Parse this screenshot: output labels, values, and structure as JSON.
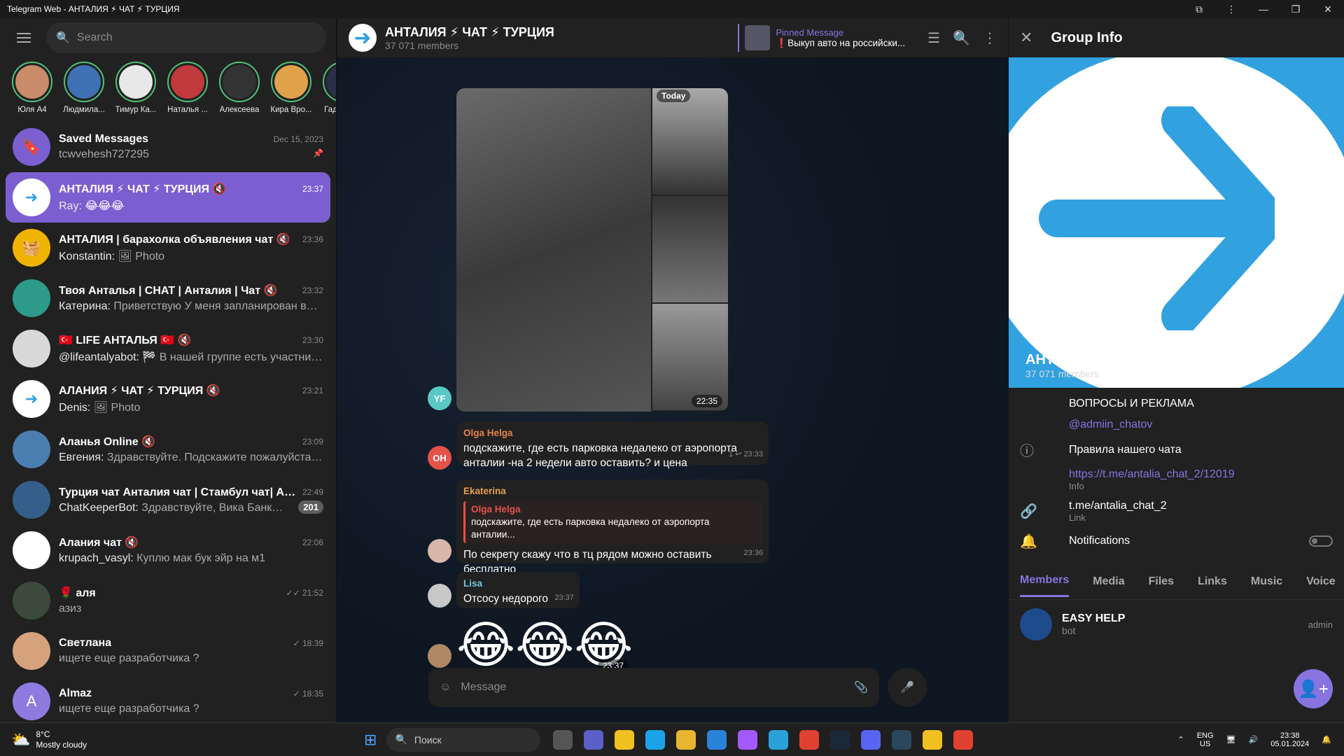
{
  "window": {
    "title": "Telegram Web - АНТАЛИЯ ⚡ ЧАТ ⚡ ТУРЦИЯ"
  },
  "search": {
    "placeholder": "Search"
  },
  "stories": [
    {
      "name": "Юля А4",
      "color": "#c98b6a"
    },
    {
      "name": "Людмила...",
      "color": "#3f72b5"
    },
    {
      "name": "Тимур Ка...",
      "color": "#e8e8e8"
    },
    {
      "name": "Наталья ...",
      "color": "#c0393b"
    },
    {
      "name": "Алексеева",
      "color": "#333333"
    },
    {
      "name": "Кира Вро...",
      "color": "#e0a24a"
    },
    {
      "name": "Гадалоч...",
      "color": "#2a2f4a"
    }
  ],
  "chats": [
    {
      "name": "Saved Messages",
      "time": "Dec 15, 2023",
      "sender": "",
      "text": "tcwvehesh727295",
      "color": "#7b5fd1",
      "glyph": "🔖",
      "pinned": "📌",
      "badge": ""
    },
    {
      "name": "АНТАЛИЯ ⚡ ЧАТ ⚡ ТУРЦИЯ 🔇",
      "time": "23:37",
      "sender": "Ray: ",
      "text": "😂😂😂",
      "color": "#ffffff",
      "glyph": "➜",
      "badge": ""
    },
    {
      "name": "АНТАЛИЯ | барахолка объявления чат 🔇",
      "time": "23:36",
      "sender": "Konstantin: ",
      "text": "🖼 Photo",
      "color": "#f0b400",
      "glyph": "🧺",
      "badge": ""
    },
    {
      "name": "Твоя Анталья | CHAT | Анталия | Чат 🔇",
      "time": "23:32",
      "sender": "Катерина: ",
      "text": "Приветствую У меня запланирован вы...",
      "color": "#2d9a8a",
      "glyph": "",
      "badge": ""
    },
    {
      "name": "🇹🇷 LIFE АНТАЛЬЯ 🇹🇷 🔇",
      "time": "23:30",
      "sender": "@lifeantalyabot: ",
      "text": "🏁 В нашей группе есть участник...",
      "color": "#d8d8d8",
      "glyph": "",
      "badge": ""
    },
    {
      "name": "АЛАНИЯ ⚡ ЧАТ ⚡ ТУРЦИЯ 🔇",
      "time": "23:21",
      "sender": "Denis: ",
      "text": "🖼 Photo",
      "color": "#ffffff",
      "glyph": "➜",
      "badge": ""
    },
    {
      "name": "Аланья Online 🔇",
      "time": "23:09",
      "sender": "Евгения: ",
      "text": "Здравствуйте. Подскажите пожалуйста ...",
      "color": "#4a7db0",
      "glyph": "",
      "badge": ""
    },
    {
      "name": "Турция чат Анталия чат | Стамбул чат| А... 🔇",
      "time": "22:49",
      "sender": "ChatKeeperBot: ",
      "text": "Здравствуйте, Вика Банкир ...",
      "color": "#355e8a",
      "glyph": "",
      "badge": "201"
    },
    {
      "name": "Алания чат 🔇",
      "time": "22:06",
      "sender": "krupach_vasyl: ",
      "text": "Куплю мак бук эйр на м1",
      "color": "#ffffff",
      "glyph": "",
      "badge": ""
    },
    {
      "name": "🌹 аля",
      "time": "✓✓ 21:52",
      "sender": "",
      "text": "азиз",
      "color": "#3b4a3b",
      "glyph": "",
      "badge": ""
    },
    {
      "name": "Светлана",
      "time": "✓ 18:39",
      "sender": "",
      "text": "ищете еще разработчика ?",
      "color": "#d6a27c",
      "glyph": "",
      "badge": ""
    },
    {
      "name": "Almaz",
      "time": "✓ 18:35",
      "sender": "",
      "text": "ищете еще разработчика ?",
      "color": "#8f7be0",
      "glyph": "A",
      "badge": ""
    }
  ],
  "chat_header": {
    "title": "АНТАЛИЯ ⚡ ЧАТ ⚡ ТУРЦИЯ",
    "members": "37 071 members"
  },
  "pinned": {
    "label": "Pinned Message",
    "text": "❗Выкуп авто на российски..."
  },
  "album": {
    "date_tag": "Today",
    "time": "22:35",
    "avatar": "YF"
  },
  "messages": [
    {
      "author": "Olga Helga",
      "author_color": "#e5824a",
      "avatar": "OH",
      "avatar_color": "#e5524a",
      "text": "подскажите, где есть  парковка недалеко от аэропорта анталии -на 2 недели  авто оставить? и цена",
      "meta": "1 ↩ 23:33"
    },
    {
      "author": "Ekaterina",
      "author_color": "#e5a14a",
      "reply_author": "Olga Helga",
      "reply_text": "подскажите, где есть парковка недалеко от аэропорта анталии...",
      "text": "По секрету скажу что в тц рядом можно оставить бесплатно",
      "meta": "23:36"
    },
    {
      "author": "Lisa",
      "author_color": "#6ec9e0",
      "text": "Отсосу недорого",
      "meta": "23:37"
    }
  ],
  "sticker": {
    "emoji": "😂😂😂",
    "time": "23:37"
  },
  "composer": {
    "placeholder": "Message"
  },
  "group_info": {
    "title": "Group Info",
    "name": "АНТАЛИЯ ⚡ ЧАТ ⚡ ТУРЦИЯ",
    "members": "37 071 members",
    "desc_line1": "ВОПРОСЫ И РЕКЛАМА",
    "desc_link": "@admiin_chatov",
    "desc_line2": "Правила нашего чата",
    "info_link": "https://t.me/antalia_chat_2/12019",
    "info_label": "Info",
    "link": "t.me/antalia_chat_2",
    "link_label": "Link",
    "notifications": "Notifications",
    "notifications_on": false,
    "tabs": [
      "Members",
      "Media",
      "Files",
      "Links",
      "Music",
      "Voice"
    ],
    "member": {
      "name": "EASY HELP",
      "status": "bot",
      "role": "admin"
    }
  },
  "taskbar": {
    "temp": "8°C",
    "weather": "Mostly cloudy",
    "search": "Поиск",
    "lang1": "ENG",
    "lang2": "US",
    "time": "23:38",
    "date": "05.01.2024"
  }
}
